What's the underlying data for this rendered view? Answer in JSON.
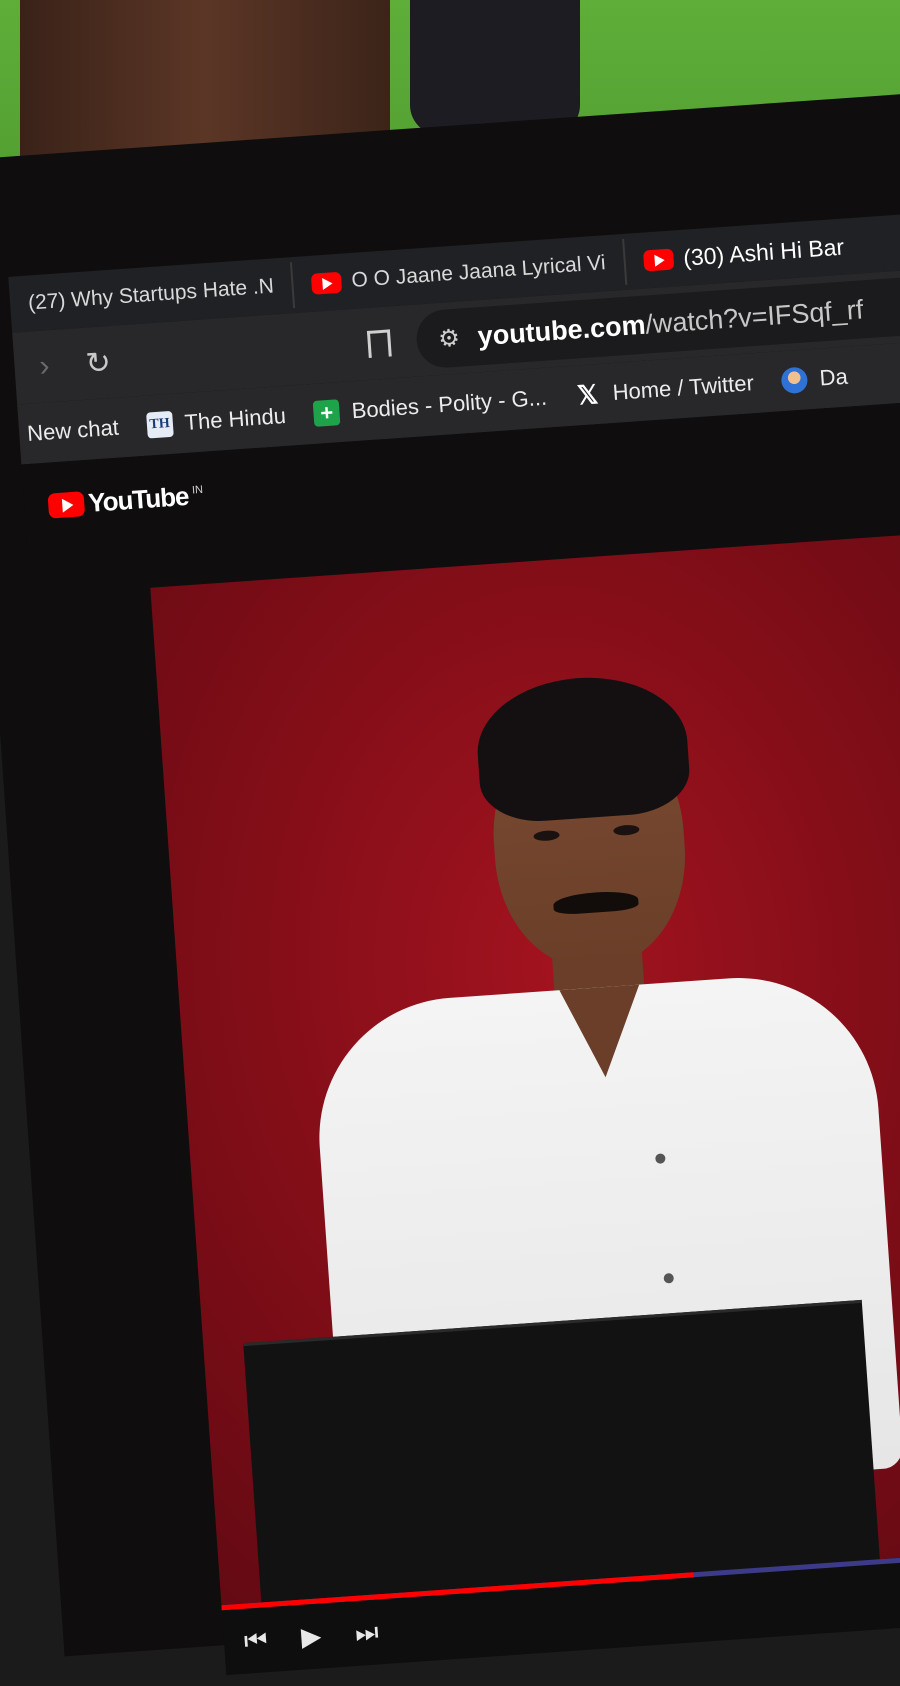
{
  "browser": {
    "tabs": [
      {
        "title": "(27) Why Startups Hate .N",
        "active": false
      },
      {
        "title": "O O Jaane Jaana Lyrical Vi",
        "active": false
      },
      {
        "title": "(30) Ashi Hi Bar",
        "active": true
      }
    ],
    "address_bar": {
      "domain": "youtube.com",
      "path": "/watch?v=IFSqf_rf"
    },
    "bookmarks": [
      {
        "label": "New chat",
        "icon": "none"
      },
      {
        "label": "The Hindu",
        "icon": "the-hindu-icon",
        "favicon_text": "TH"
      },
      {
        "label": "Bodies - Polity - G...",
        "icon": "green-plus-icon",
        "favicon_text": "+"
      },
      {
        "label": "Home / Twitter",
        "icon": "x-logo-icon",
        "favicon_text": "𝕏"
      },
      {
        "label": "Da",
        "icon": "avatar-icon"
      }
    ]
  },
  "youtube": {
    "logo_text": "YouTube",
    "country_code": "IN"
  },
  "player": {
    "progress_fraction": 0.55
  },
  "colors": {
    "youtube_red": "#ff0000",
    "chrome_dark": "#202124",
    "backdrop_red": "#8b0f1a"
  },
  "icons": {
    "back": "‹",
    "forward": "›",
    "reload": "↻",
    "tune": "⚙",
    "skip_back": "⏮",
    "play": "▶",
    "skip_next": "⏭"
  }
}
